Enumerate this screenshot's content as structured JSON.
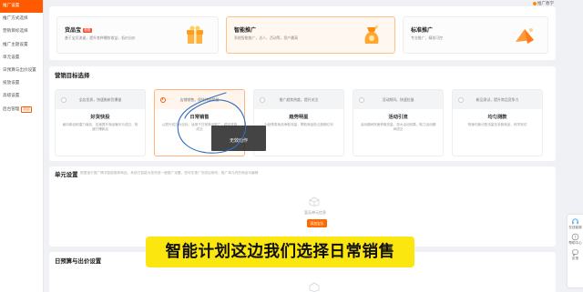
{
  "sidebar": {
    "items": [
      {
        "label": "推广设置",
        "active": true
      },
      {
        "label": "推广方式选择",
        "active": false
      },
      {
        "label": "营销目标选择",
        "active": false
      },
      {
        "label": "推广主题设置",
        "active": false
      },
      {
        "label": "单元设置",
        "active": false
      },
      {
        "label": "日预算与出价设置",
        "active": false
      },
      {
        "label": "投放设置",
        "active": false
      },
      {
        "label": "高级设置",
        "active": false
      },
      {
        "label": "后台管理",
        "active": false,
        "badge": "收起"
      }
    ]
  },
  "header": {
    "help_label": "推广教学"
  },
  "promo_types": [
    {
      "title": "货品宝",
      "tag": "首推",
      "desc": "基于宝贝流量，提升各种爆款收益，低价出价",
      "selected": false,
      "icon": "gift-box-icon"
    },
    {
      "title": "智能推广",
      "tag": "",
      "desc": "系统智能推广，达人、活动等，投产最高",
      "selected": true,
      "icon": "money-bag-icon"
    },
    {
      "title": "标准推广",
      "tag": "",
      "desc": "专业推广，精准可控",
      "selected": false,
      "icon": "cone-icon"
    }
  ],
  "goal": {
    "title": "营销目标选择",
    "cards": [
      {
        "head": "全店优质，快速推新货爆量",
        "name": "好货快投",
        "desc": "面向新品和潜力商品，迅速提升商品曝光与成交，快速打爆新品",
        "selected": false
      },
      {
        "head": "店铺销售，保持持续销量",
        "name": "日常销售",
        "desc": "以提升成交为目标，适用于日常商品推广，稳定获取成交",
        "selected": true
      },
      {
        "head": "推广趋势热度，提升关注",
        "name": "趋势明星",
        "desc": "为趋势类商品争取流量，帮助商品抢占趋势红利",
        "selected": false
      },
      {
        "head": "活动期间，快速拉量",
        "name": "活动引流",
        "desc": "活动期间快速获取流量，放大活动效果，助力活动期间成交",
        "selected": false
      },
      {
        "head": "新品测试，提升商品竞争力",
        "name": "均匀测款",
        "desc": "快速均衡分配流量至多款商品，科学测试",
        "selected": false
      }
    ]
  },
  "overlay": {
    "text": "无效动作"
  },
  "unit": {
    "title": "单元设置",
    "hint": "根据宝贝推广情况智能推荐商品，系统已智能为您完成一键推广设置，您可在推广完成后修改，推广单元内的商品可编辑",
    "empty_text": "暂无单元信息",
    "add_label": "添加宝贝"
  },
  "bid": {
    "title": "日预算与出价设置"
  },
  "subtitle": "智能计划这边我们选择日常销售",
  "right_tools": [
    {
      "label": "在线客服",
      "icon": "headset-icon"
    },
    {
      "label": "帮助中心",
      "icon": "question-icon"
    },
    {
      "label": "反馈",
      "icon": "feedback-icon"
    }
  ],
  "colors": {
    "accent": "#ff5a00",
    "subtitle_bg": "#fbe70f",
    "circle": "#2f6fbf"
  }
}
